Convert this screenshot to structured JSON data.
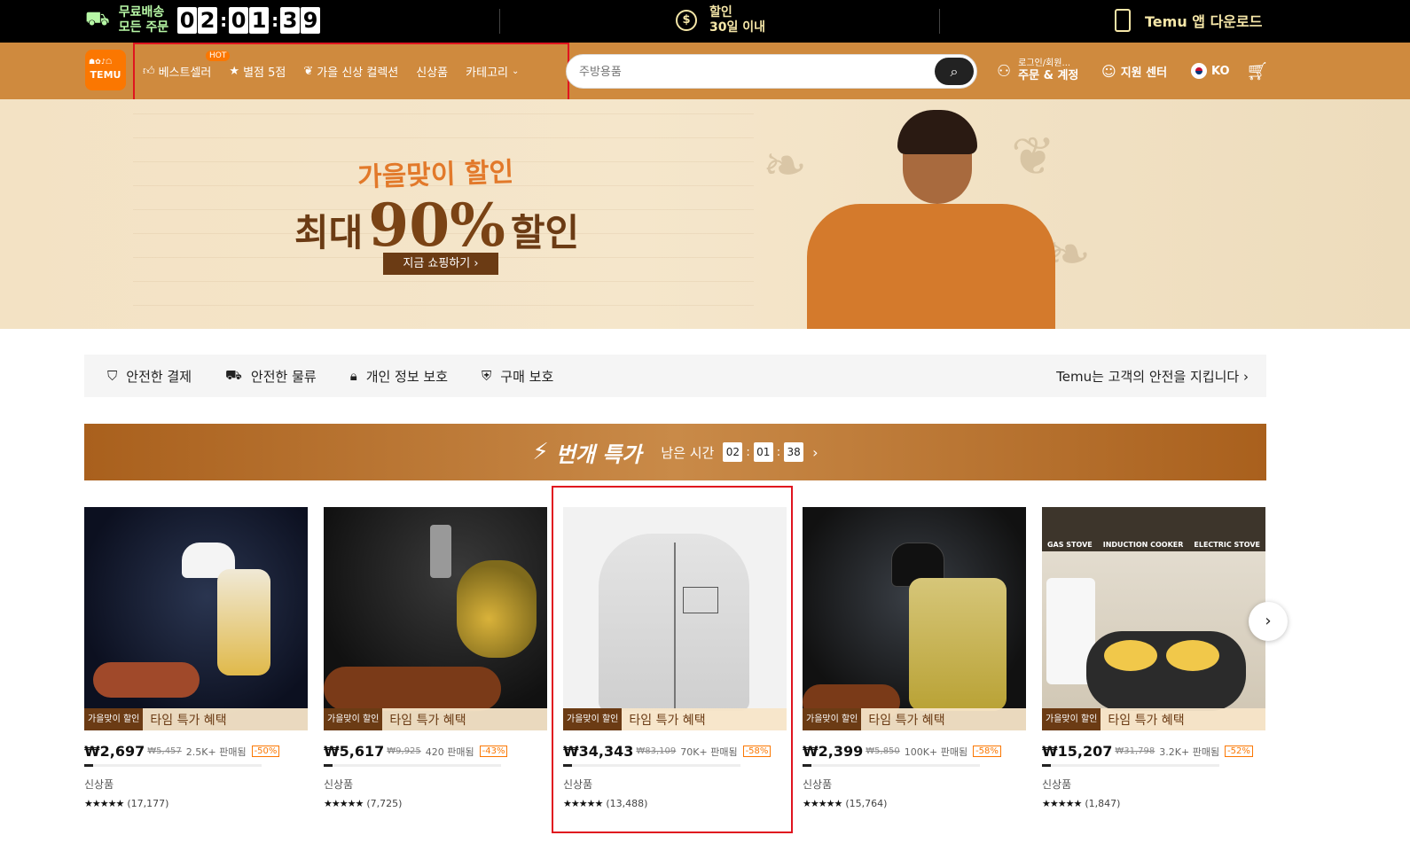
{
  "topbar": {
    "free_line1": "무료배송",
    "free_line2": "모든 주문",
    "timer": [
      "0",
      "2",
      "0",
      "1",
      "3",
      "9"
    ],
    "discount_line1": "할인",
    "discount_line2": "30일 이내",
    "coin_symbol": "$",
    "app_download": "Temu 앱 다운로드"
  },
  "header": {
    "logo_text": "TEMU",
    "nav": [
      {
        "label": "베스트셀러",
        "icon": "thumbs-up-icon",
        "badge": "HOT"
      },
      {
        "label": "별점 5점",
        "icon": "star-icon"
      },
      {
        "label": "가을 신상 컬렉션",
        "icon": "maple-leaf-icon"
      },
      {
        "label": "신상품"
      },
      {
        "label": "카테고리",
        "icon": "chevron-down-icon"
      }
    ],
    "search_placeholder": "주방용품",
    "account_small": "로그인/회원...",
    "account_big": "주문 & 계정",
    "support": "지원 센터",
    "language": "KO"
  },
  "banner": {
    "subtitle": "가을맞이 할인",
    "main_prefix": "최대",
    "main_percent": "90%",
    "main_suffix": "할인",
    "button": "지금 쇼핑하기 ›"
  },
  "trust": {
    "items": [
      "안전한 결제",
      "안전한 물류",
      "개인 정보 보호",
      "구매 보호"
    ],
    "right": "Temu는 고객의 안전을 지킵니다 ›"
  },
  "flash": {
    "title": "번개 특가",
    "time_left": "남은 시간",
    "hh": "02",
    "mm": "01",
    "ss": "38"
  },
  "product_tags": {
    "tag1": "가을맞이 할인",
    "tag2": "타임 특가 혜택"
  },
  "products": [
    {
      "price": "₩2,697",
      "orig": "₩5,457",
      "sold": "2.5K+ 판매됨",
      "disc": "-50%",
      "progress": 0.05,
      "label": "신상품",
      "stars": "★★★★★",
      "count": "(17,177)"
    },
    {
      "price": "₩5,617",
      "orig": "₩9,925",
      "sold": "420 판매됨",
      "disc": "-43%",
      "progress": 0.05,
      "label": "신상품",
      "stars": "★★★★★",
      "count": "(7,725)"
    },
    {
      "price": "₩34,343",
      "orig": "₩83,109",
      "sold": "70K+ 판매됨",
      "disc": "-58%",
      "progress": 0.05,
      "label": "신상품",
      "stars": "★★★★★",
      "count": "(13,488)"
    },
    {
      "price": "₩2,399",
      "orig": "₩5,850",
      "sold": "100K+ 판매됨",
      "disc": "-58%",
      "progress": 0.05,
      "label": "신상품",
      "stars": "★★★★★",
      "count": "(15,764)"
    },
    {
      "price": "₩15,207",
      "orig": "₩31,798",
      "sold": "3.2K+ 판매됨",
      "disc": "-52%",
      "progress": 0.05,
      "label": "신상품",
      "stars": "★★★★★",
      "count": "(1,847)"
    }
  ],
  "product5_image_labels": [
    "GAS STOVE",
    "INDUCTION COOKER",
    "ELECTRIC STOVE"
  ],
  "colors": {
    "header": "#cf8a3e",
    "accent": "#fb7701",
    "highlight": "#e0141f"
  }
}
